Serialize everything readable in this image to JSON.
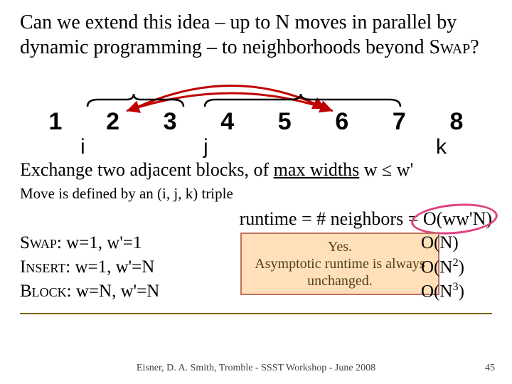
{
  "title_part1": "Can we extend this idea – up to N moves in parallel by dynamic programming – to neighborhoods beyond ",
  "title_swap": "Swap",
  "title_q": "?",
  "seq": {
    "n1": "1",
    "n2": "2",
    "n3": "3",
    "n4": "4",
    "n5": "5",
    "n6": "6",
    "n7": "7",
    "n8": "8"
  },
  "ptr": {
    "i": "i",
    "j": "j",
    "k": "k"
  },
  "exchange_a": "Exchange two adjacent blocks, of ",
  "exchange_u": "max widths",
  "exchange_b": " w ≤ w'",
  "move_line": "Move is defined by an (i, j, k) triple",
  "runtime_label": "runtime = # neighbors =",
  "rows": {
    "swap_name": "Swap:",
    "swap_vals": " w=1, w'=1",
    "ins_name": "Insert:",
    "ins_vals": " w=1, w'=N",
    "blk_name": "Block:",
    "blk_vals": " w=N, w'=N"
  },
  "big_o": {
    "header": " O(ww'N)",
    "swap": "O(N)",
    "ins_pre": "O(N",
    "ins_sup": "2",
    "ins_post": ")",
    "blk_pre": "O(N",
    "blk_sup": "3",
    "blk_post": ")"
  },
  "yes_box": {
    "line1": "Yes.",
    "line2": "Asymptotic runtime is always unchanged."
  },
  "footer": "Eisner, D. A. Smith, Tromble - SSST Workshop - June 2008",
  "page": "45"
}
